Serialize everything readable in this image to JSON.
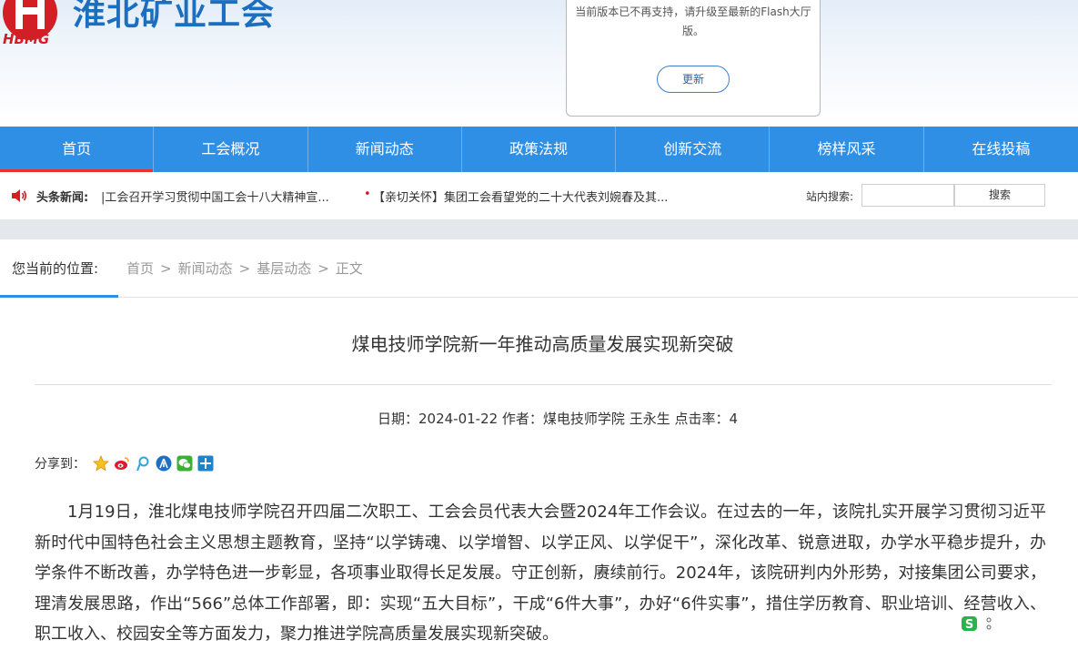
{
  "header": {
    "logo_abbr": "HBMG",
    "site_name": "淮北矿业工会",
    "flash_notice": {
      "message": "当前版本已不再支持，请升级至最新的Flash大厅版。",
      "button_label": "更新"
    }
  },
  "nav": {
    "items": [
      {
        "label": "首页",
        "active": true
      },
      {
        "label": "工会概况"
      },
      {
        "label": "新闻动态"
      },
      {
        "label": "政策法规"
      },
      {
        "label": "创新交流"
      },
      {
        "label": "榜样风采"
      },
      {
        "label": "在线投稿"
      }
    ]
  },
  "ticker": {
    "label": "头条新闻:",
    "items": [
      "|工会召开学习贯彻中国工会十八大精神宣...",
      "【亲切关怀】集团工会看望党的二十大代表刘婉春及其..."
    ],
    "bullet": "•"
  },
  "search": {
    "label": "站内搜索:",
    "placeholder": "",
    "button_label": "搜索"
  },
  "breadcrumb": {
    "label": "您当前的位置:",
    "items": [
      "首页",
      "新闻动态",
      "基层动态",
      "正文"
    ],
    "separator": ">"
  },
  "article": {
    "title": "煤电技师学院新一年推动高质量发展实现新突破",
    "meta": "日期：2024-01-22 作者：煤电技师学院 王永生 点击率：4",
    "share_label": "分享到：",
    "share_icons": [
      "qzone-icon",
      "weibo-icon",
      "tencent-weibo-icon",
      "renren-icon",
      "wechat-icon",
      "more-share-icon"
    ],
    "body": "1月19日，淮北煤电技师学院召开四届二次职工、工会会员代表大会暨2024年工作会议。在过去的一年，该院扎实开展学习贯彻习近平新时代中国特色社会主义思想主题教育，坚持“以学铸魂、以学增智、以学正风、以学促干”，深化改革、锐意进取，办学水平稳步提升，办学条件不断改善，办学特色进一步彰显，各项事业取得长足发展。守正创新，赓续前行。2024年，该院研判内外形势，对接集团公司要求，理清发展思路，作出“566”总体工作部署，即：实现“五大目标”，干成“6件大事”，办好“6件实事”，措住学历教育、职业培训、经营收入、职工收入、校园安全等方面发力，聚力推进学院高质量发展实现新突破。"
  },
  "colors": {
    "nav_bg": "#2f8fe5",
    "brand_blue": "#1c6fbf",
    "brand_red": "#d21f26",
    "active_underline": "#e8352b"
  }
}
